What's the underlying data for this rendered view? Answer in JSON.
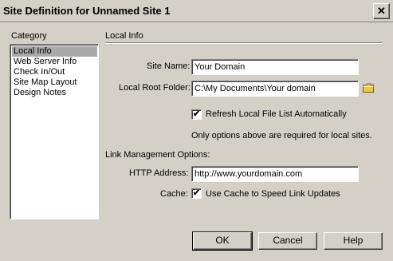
{
  "window": {
    "title": "Site Definition for Unnamed Site 1",
    "close_glyph": "✕"
  },
  "category": {
    "label": "Category",
    "items": [
      "Local Info",
      "Web Server Info",
      "Check In/Out",
      "Site Map Layout",
      "Design Notes"
    ],
    "selected": "Local Info"
  },
  "local_info": {
    "section_title": "Local Info",
    "site_name_label": "Site Name:",
    "site_name_value": "Your Domain",
    "root_folder_label": "Local Root Folder:",
    "root_folder_value": "C:\\My Documents\\Your domain",
    "refresh_label": "Refresh Local File List Automatically",
    "refresh_checked": true,
    "note": "Only options above are required for local sites."
  },
  "link_management": {
    "title": "Link Management Options:",
    "http_label": "HTTP Address:",
    "http_value": "http://www.yourdomain.com",
    "cache_label": "Cache:",
    "cache_option_label": "Use Cache to Speed Link Updates",
    "cache_checked": true
  },
  "buttons": {
    "ok": "OK",
    "cancel": "Cancel",
    "help": "Help"
  },
  "icons": {
    "folder": "folder-icon",
    "close": "close-icon",
    "checkmark": "✔"
  },
  "colors": {
    "dialog_bg": "#d4d0c8",
    "selection": "#a9a9a9",
    "folder": "#e8c840"
  }
}
